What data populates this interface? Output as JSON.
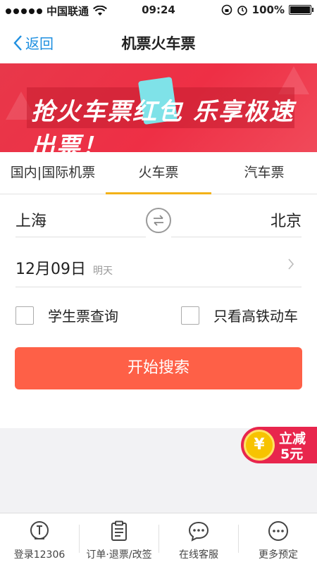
{
  "status": {
    "carrier": "中国联通",
    "time": "09:24",
    "battery": "100%",
    "battery_level": 1.0
  },
  "nav": {
    "back_label": "返回",
    "title": "机票火车票"
  },
  "banner": {
    "text": "抢火车票红包 乐享极速出票！",
    "badge": "5元"
  },
  "tabs": [
    {
      "label": "国内|国际机票",
      "active": false
    },
    {
      "label": "火车票",
      "active": true
    },
    {
      "label": "汽车票",
      "active": false
    }
  ],
  "form": {
    "from_city": "上海",
    "to_city": "北京",
    "date": "12月09日",
    "day_label": "明天",
    "student_label": "学生票查询",
    "highspeed_label": "只看高铁动车",
    "search_label": "开始搜索"
  },
  "promo": {
    "line1": "立减",
    "line2": "5元",
    "coin_symbol": "¥"
  },
  "tabbar": [
    {
      "label": "登录12306",
      "icon": "train-icon"
    },
    {
      "label": "订单·退票/改签",
      "icon": "clipboard-icon"
    },
    {
      "label": "在线客服",
      "icon": "chat-icon"
    },
    {
      "label": "更多预定",
      "icon": "more-icon"
    }
  ],
  "colors": {
    "accent": "#1e8fe0",
    "tab_indicator": "#f3b218",
    "search_button": "#fe6047",
    "banner": "#ee2f45"
  }
}
